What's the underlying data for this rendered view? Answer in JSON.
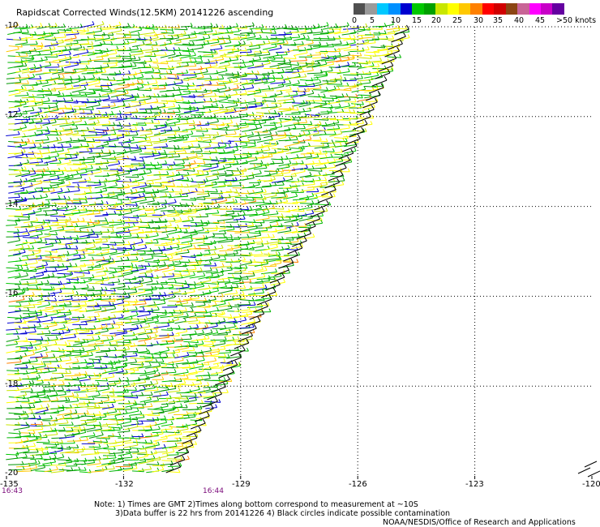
{
  "title": "Rapidscat Corrected Winds(12.5KM) 20141226 ascending",
  "speed_scale": {
    "colors": [
      "#505050",
      "#9a9a9a",
      "#00c8ff",
      "#0090ff",
      "#0000d0",
      "#00c800",
      "#00a000",
      "#c8e600",
      "#ffff00",
      "#ffc800",
      "#ff8000",
      "#ff0000",
      "#d00000",
      "#8b4513",
      "#c86496",
      "#ff00ff",
      "#c800c8",
      "#6400a0"
    ],
    "labels": [
      "0",
      "5",
      "10",
      "15",
      "20",
      "25",
      "30",
      "35",
      "40",
      "45",
      ">50 knots"
    ]
  },
  "chart_data": {
    "type": "wind-barb map",
    "x_ticks": [
      "-135",
      "-132",
      "-129",
      "-126",
      "-123",
      "-120"
    ],
    "y_ticks": [
      "-10",
      "-12",
      "-14",
      "-16",
      "-18",
      "-20"
    ],
    "xlim": [
      -135,
      -120
    ],
    "ylim": [
      -20,
      -10
    ],
    "swath_edge": [
      [
        -124.8,
        -10
      ],
      [
        -125.8,
        -12
      ],
      [
        -126.9,
        -14
      ],
      [
        -128.3,
        -16
      ],
      [
        -129.5,
        -18
      ],
      [
        -130.8,
        -20
      ]
    ]
  },
  "time_labels": [
    "16:43",
    "16:44"
  ],
  "notes": [
    "Note: 1) Times are GMT 2)Times along bottom correspond to measurement at ~10S",
    "3)Data buffer is 22 hrs from 20141226 4) Black circles indicate possible contamination",
    "NOAA/NESDIS/Office of Research and Applications"
  ]
}
